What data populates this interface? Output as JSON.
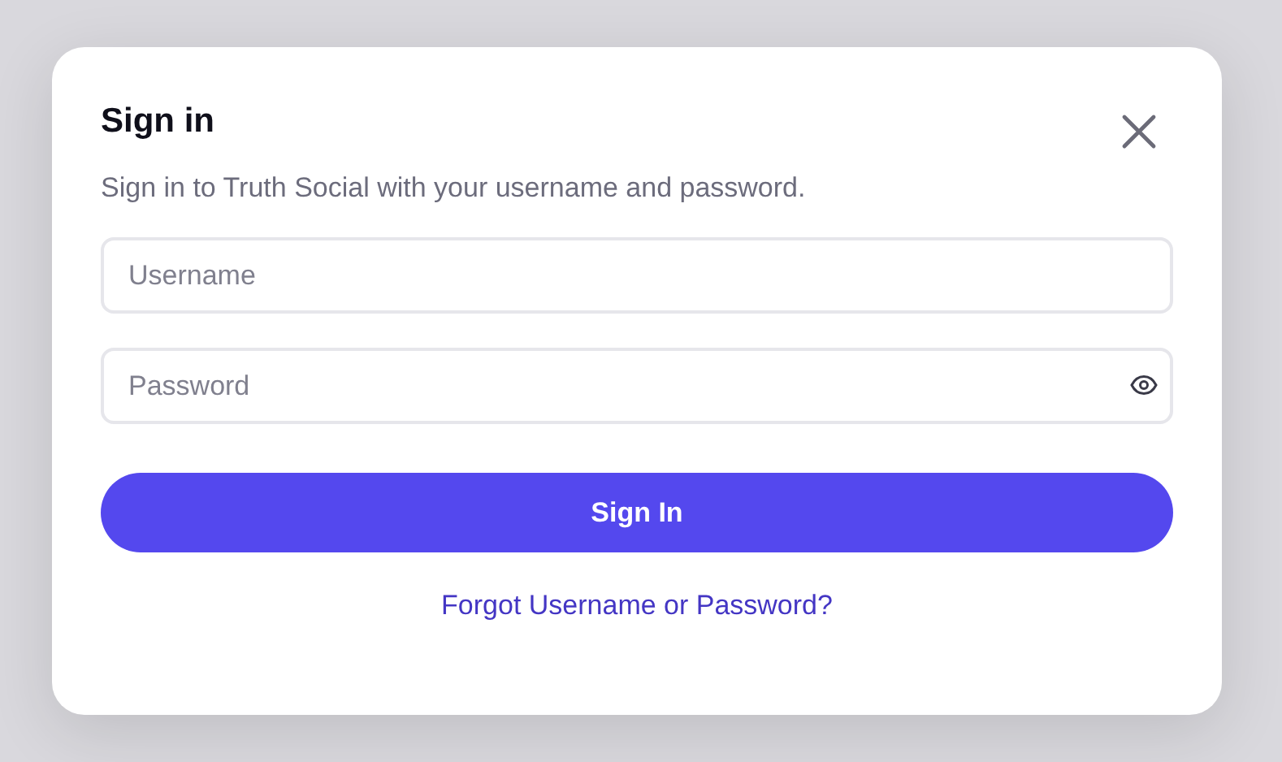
{
  "dialog": {
    "title": "Sign in",
    "subtitle": "Sign in to Truth Social with your username and password.",
    "fields": [
      {
        "kind": "text",
        "placeholder": "Username"
      },
      {
        "kind": "password",
        "placeholder": "Password"
      }
    ],
    "submit_button": "Sign In",
    "forgot_link": "Forgot Username or Password?"
  }
}
